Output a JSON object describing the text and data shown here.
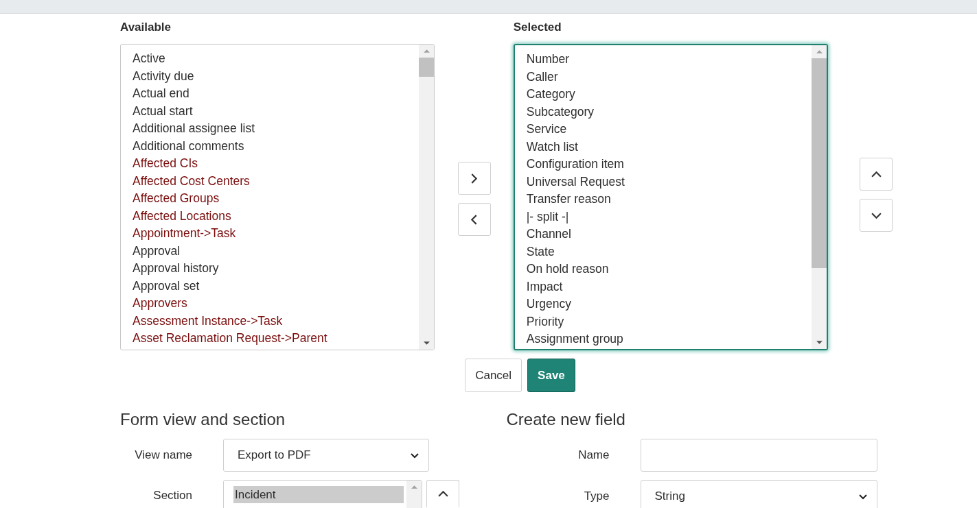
{
  "available": {
    "heading": "Available",
    "focused": false,
    "items": [
      {
        "label": "Active",
        "kind": "field"
      },
      {
        "label": "Activity due",
        "kind": "field"
      },
      {
        "label": "Actual end",
        "kind": "field"
      },
      {
        "label": "Actual start",
        "kind": "field"
      },
      {
        "label": "Additional assignee list",
        "kind": "field"
      },
      {
        "label": "Additional comments",
        "kind": "field"
      },
      {
        "label": "Affected CIs",
        "kind": "reference"
      },
      {
        "label": "Affected Cost Centers",
        "kind": "reference"
      },
      {
        "label": "Affected Groups",
        "kind": "reference"
      },
      {
        "label": "Affected Locations",
        "kind": "reference"
      },
      {
        "label": "Appointment->Task",
        "kind": "reference"
      },
      {
        "label": "Approval",
        "kind": "field"
      },
      {
        "label": "Approval history",
        "kind": "field"
      },
      {
        "label": "Approval set",
        "kind": "field"
      },
      {
        "label": "Approvers",
        "kind": "reference"
      },
      {
        "label": "Assessment Instance->Task",
        "kind": "reference"
      },
      {
        "label": "Asset Reclamation Request->Parent",
        "kind": "reference"
      }
    ]
  },
  "selected": {
    "heading": "Selected",
    "focused": true,
    "items": [
      {
        "label": "Number"
      },
      {
        "label": "Caller"
      },
      {
        "label": "Category"
      },
      {
        "label": "Subcategory"
      },
      {
        "label": "Service"
      },
      {
        "label": "Watch list"
      },
      {
        "label": "Configuration item"
      },
      {
        "label": "Universal Request"
      },
      {
        "label": "Transfer reason"
      },
      {
        "label": "|- split -|"
      },
      {
        "label": "Channel"
      },
      {
        "label": "State"
      },
      {
        "label": "On hold reason"
      },
      {
        "label": "Impact"
      },
      {
        "label": "Urgency"
      },
      {
        "label": "Priority"
      },
      {
        "label": "Assignment group"
      }
    ]
  },
  "actions": {
    "cancel": "Cancel",
    "save": "Save"
  },
  "form_view": {
    "heading": "Form view and section",
    "view_name_label": "View name",
    "view_name": "Export to PDF",
    "section_label": "Section",
    "sections": [
      {
        "label": "Incident",
        "selected": true
      }
    ]
  },
  "create_field": {
    "heading": "Create new field",
    "name_label": "Name",
    "type_label": "Type",
    "type_value": "String"
  }
}
